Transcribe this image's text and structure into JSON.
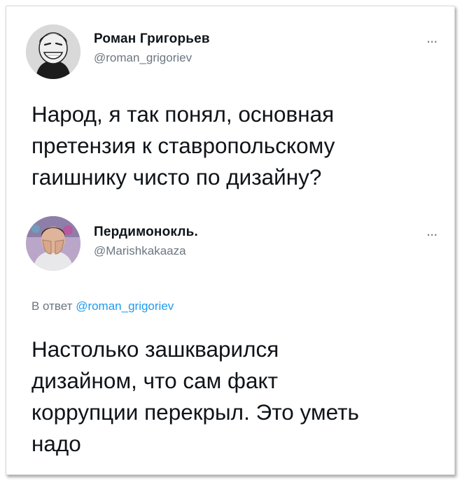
{
  "tweets": [
    {
      "author": "Роман Григорьев",
      "handle": "@roman_grigoriev",
      "more": "...",
      "text": "Народ, я так понял, основная\nпретензия к ставропольскому\nгаишнику чисто по дизайну?",
      "avatar_icon": "trollface-avatar"
    },
    {
      "author": "Пердимонокль.",
      "handle": "@Marishkakaaza",
      "more": "...",
      "reply_prefix": "В ответ",
      "reply_to": "@roman_grigoriev",
      "text": "Настолько зашкварился\nдизайном, что сам факт\nкоррупции перекрыл. Это уметь\nнадо",
      "avatar_icon": "face-in-hands-avatar"
    }
  ],
  "colors": {
    "text": "#0f1419",
    "secondary": "#6b7680",
    "link": "#1d9bf0"
  }
}
